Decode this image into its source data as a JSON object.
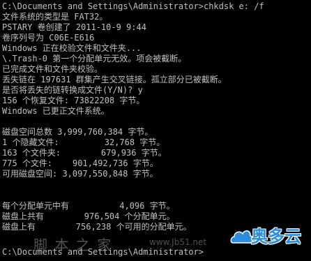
{
  "console": {
    "lines": [
      "C:\\Documents and Settings\\Administrator>chkdsk e: /f",
      "文件系统的类型是 FAT32。",
      "PSTARY 卷创建了 2011-10-9 9:44",
      "卷序列号为 C06E-E616",
      "Windows 正在校验文件和文件夹...",
      "\\.Trash-0 第一个分配单元无效。项会被截断。",
      "已完成文件和文件夹校验。",
      "丢失链在 197631 群集产生交叉链接。孤立部分已被截断。",
      "是否将丢失的链转换成文件(Y/N)? y",
      "156 个恢复文件: 73822208 字节。",
      "Windows 已更正文件系统。",
      "",
      "磁盘空间总数 3,999,760,384 字节。",
      "1 个隐藏文件:         32,768 字节。",
      "163 个文件夹:        679,936 字节。",
      "775 个文件:    901,492,736 字节。",
      "可用磁盘空间: 3,097,550,848 字节。",
      "",
      "每个分配单元中有          4,096 字节。",
      "磁盘上共有        976,504 个分配单元。",
      "磁盘上有        756,238 个可用的分配单元。",
      "",
      "C:\\Documents and Settings\\Administrator>"
    ]
  },
  "watermark": {
    "text": "脚 本 之 家",
    "url": "www.Jb51.net"
  },
  "logo": {
    "text": "奥多云",
    "color": "#2a8de0"
  }
}
